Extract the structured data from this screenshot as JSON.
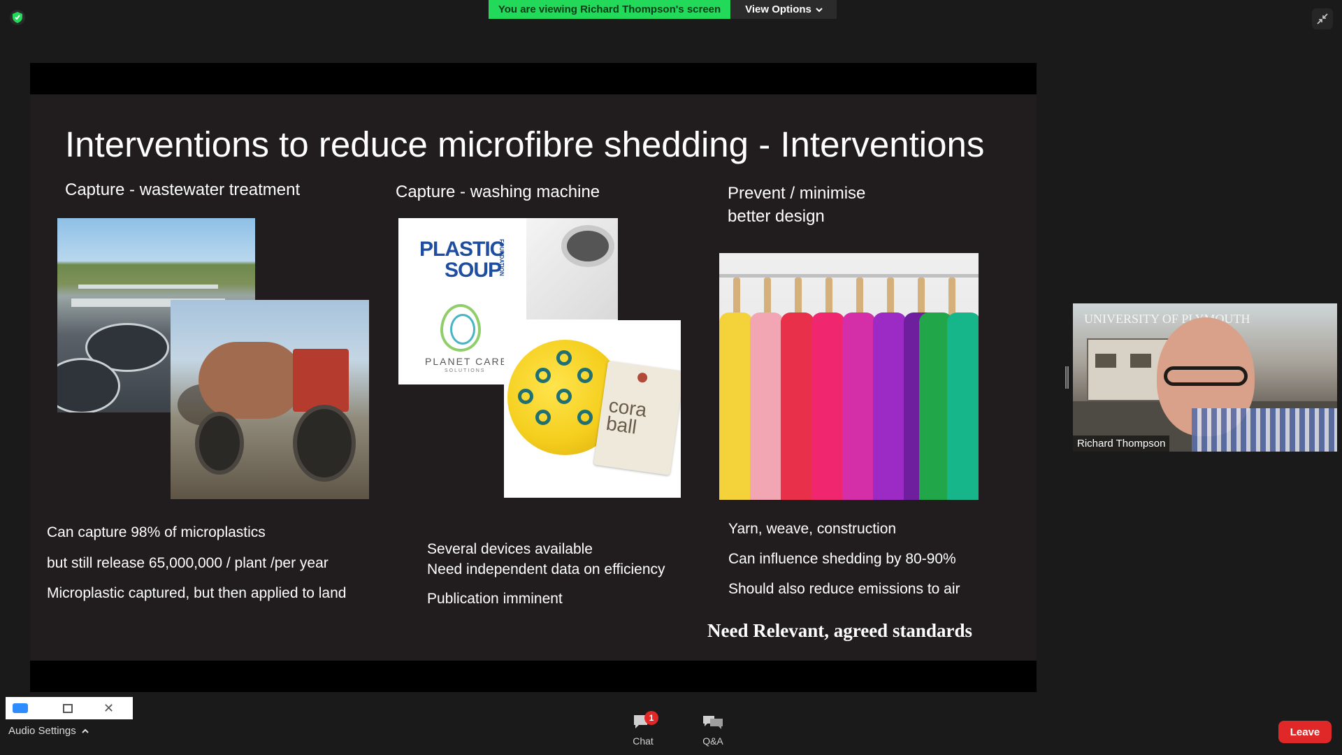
{
  "top_bar": {
    "viewing_banner": "You are viewing Richard Thompson's screen",
    "view_options": "View Options"
  },
  "slide": {
    "title": "Interventions to reduce microfibre shedding - Interventions",
    "columns": [
      {
        "heading": "Capture - wastewater treatment",
        "bullets": [
          "Can capture  98% of microplastics",
          "but  still release 65,000,000 / plant /per year",
          "Microplastic captured, but then applied to land"
        ]
      },
      {
        "heading": "Capture  - washing machine",
        "bullets": [
          "Several devices available",
          "Need independent data on efficiency",
          "Publication imminent"
        ]
      },
      {
        "heading_lines": [
          "Prevent / minimise",
          "better design"
        ],
        "bullets": [
          "Yarn, weave, construction",
          "Can influence  shedding by 80-90%",
          "Should  also reduce emissions to air"
        ]
      }
    ],
    "footer_note": "Need Relevant, agreed standards",
    "logos": {
      "plastic_soup_line1": "PLASTIC",
      "plastic_soup_line2": "SOUP",
      "plastic_soup_foundation": "FOUNDATION",
      "planet_care": "PLANET CARE",
      "planet_care_sub": "SOLUTIONS",
      "cora_ball": "cora ball"
    }
  },
  "participant": {
    "name": "Richard Thompson",
    "background_text": "UNIVERSITY OF PLYMOUTH"
  },
  "bottom_bar": {
    "audio_settings": "Audio Settings",
    "chat_label": "Chat",
    "chat_badge": "1",
    "qa_label": "Q&A",
    "leave_label": "Leave"
  },
  "colors": {
    "banner_green": "#23d959",
    "leave_red": "#e02828",
    "slide_bg": "#211d1e"
  },
  "icons": [
    "shield-icon",
    "chevron-down-icon",
    "exit-fullscreen-icon",
    "chat-icon",
    "qa-icon",
    "chevron-up-icon"
  ]
}
